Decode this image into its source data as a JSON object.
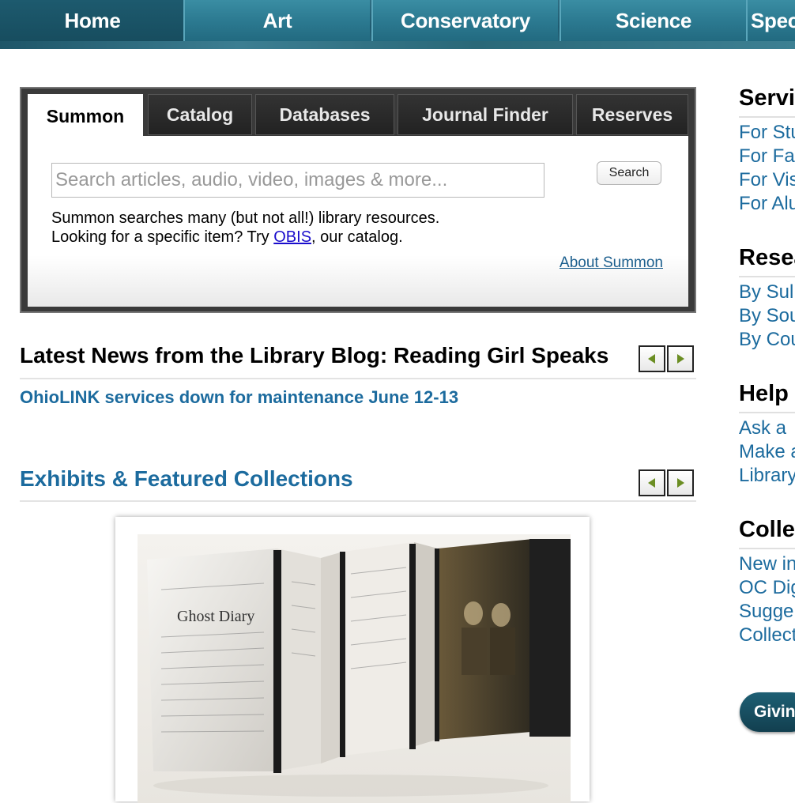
{
  "nav": {
    "items": [
      {
        "label": "Home"
      },
      {
        "label": "Art"
      },
      {
        "label": "Conservatory"
      },
      {
        "label": "Science"
      },
      {
        "label": "Spec"
      }
    ]
  },
  "search": {
    "tabs": [
      {
        "label": "Summon"
      },
      {
        "label": "Catalog"
      },
      {
        "label": "Databases"
      },
      {
        "label": "Journal Finder"
      },
      {
        "label": "Reserves"
      }
    ],
    "placeholder": "Search articles, audio, video, images & more...",
    "button_label": "Search",
    "help_line1": "Summon searches many (but not all!) library resources.",
    "help_line2_prefix": "Looking for a specific item? Try ",
    "help_link": "OBIS",
    "help_line2_suffix": ", our catalog.",
    "about_link": "About Summon"
  },
  "news": {
    "title": "Latest News from the Library Blog:  Reading Girl Speaks",
    "headline": "OhioLINK services down for maintenance June 12-13"
  },
  "exhibits": {
    "title": "Exhibits & Featured Collections",
    "image_caption": "Ghost Diary"
  },
  "sidebar": {
    "sections": [
      {
        "heading": "Servi",
        "links": [
          "For Stu",
          "For Fa",
          "For Vis",
          "For Alu"
        ]
      },
      {
        "heading": "Resea",
        "links": [
          "By Sul",
          "By Sou",
          "By Cou"
        ]
      },
      {
        "heading": "Help",
        "links": [
          "Ask a",
          "Make a",
          "Library"
        ]
      },
      {
        "heading": "Colle",
        "links": [
          "New in",
          "OC Dig",
          "Sugge",
          "Collect"
        ]
      }
    ],
    "giving_label": "Givin"
  },
  "colors": {
    "nav_teal": "#2c7a91",
    "link_blue": "#1c6b9e",
    "arrow_green": "#6b8e23"
  }
}
